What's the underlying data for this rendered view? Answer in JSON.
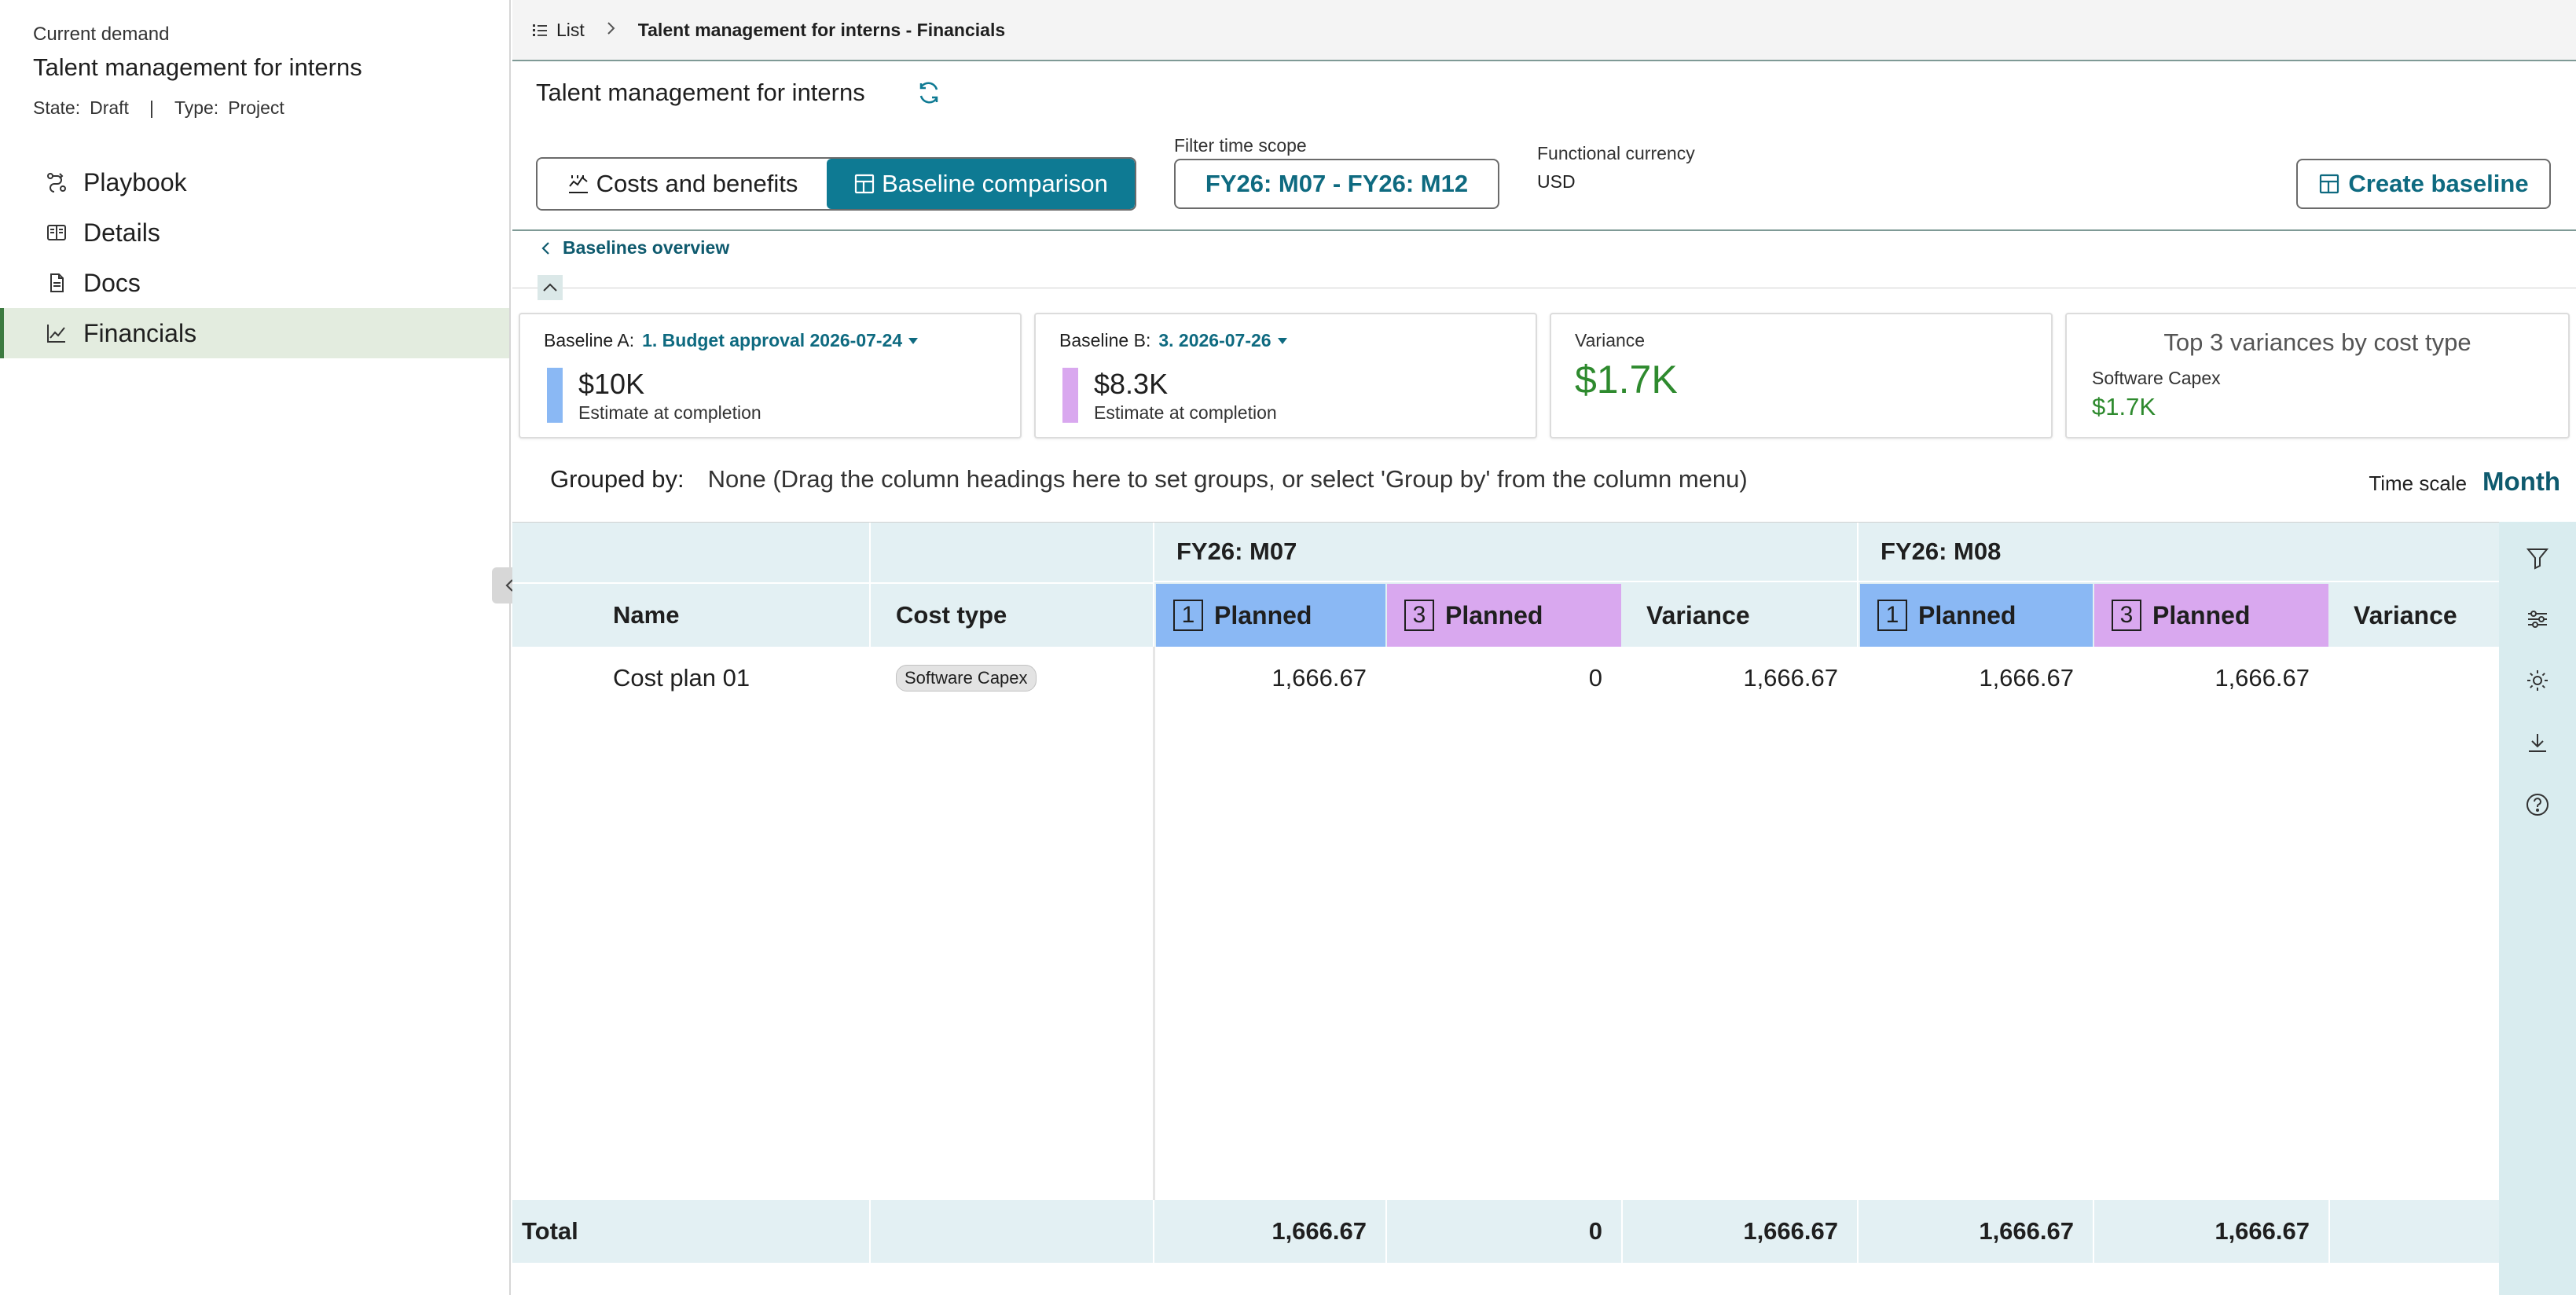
{
  "sidebar": {
    "context_label": "Current demand",
    "title": "Talent management for interns",
    "state_label": "State:",
    "state_value": "Draft",
    "separator": "|",
    "type_label": "Type:",
    "type_value": "Project",
    "items": [
      {
        "label": "Playbook",
        "icon": "playbook-icon",
        "active": false
      },
      {
        "label": "Details",
        "icon": "details-icon",
        "active": false
      },
      {
        "label": "Docs",
        "icon": "document-icon",
        "active": false
      },
      {
        "label": "Financials",
        "icon": "chart-line-icon",
        "active": true
      }
    ]
  },
  "breadcrumb": {
    "list_label": "List",
    "current": "Talent management for interns - Financials"
  },
  "header": {
    "title": "Talent management for interns",
    "tabs": [
      {
        "label": "Costs and benefits",
        "selected": false
      },
      {
        "label": "Baseline comparison",
        "selected": true
      }
    ],
    "filter_label": "Filter time scope",
    "filter_value": "FY26: M07 - FY26: M12",
    "currency_label": "Functional currency",
    "currency_value": "USD",
    "create_label": "Create baseline",
    "back_link": "Baselines overview"
  },
  "cards": {
    "baseline_a": {
      "label": "Baseline A:",
      "value": "1. Budget approval 2026-07-24",
      "amount": "$10K",
      "sub": "Estimate at completion",
      "color": "#8ab8f4"
    },
    "baseline_b": {
      "label": "Baseline B:",
      "value": "3. 2026-07-26",
      "amount": "$8.3K",
      "sub": "Estimate at completion",
      "color": "#d9a8ef"
    },
    "variance": {
      "label": "Variance",
      "value": "$1.7K"
    },
    "top3": {
      "title": "Top 3 variances by cost type",
      "item": "Software Capex",
      "value": "$1.7K"
    }
  },
  "grouping": {
    "label": "Grouped by:",
    "help": "None (Drag the column headings here to set groups, or select 'Group by' from the column menu)",
    "timescale_label": "Time scale",
    "timescale_value": "Month"
  },
  "grid": {
    "col_name": "Name",
    "col_cost_type": "Cost type",
    "months": [
      {
        "label": "FY26: M07",
        "cols": [
          {
            "num": "1",
            "label": "Planned"
          },
          {
            "num": "3",
            "label": "Planned"
          },
          {
            "label": "Variance"
          }
        ]
      },
      {
        "label": "FY26: M08",
        "cols": [
          {
            "num": "1",
            "label": "Planned"
          },
          {
            "num": "3",
            "label": "Planned"
          },
          {
            "label": "Variance"
          }
        ]
      }
    ],
    "rows": [
      {
        "name": "Cost plan 01",
        "cost_type": "Software Capex",
        "values": [
          "1,666.67",
          "0",
          "1,666.67",
          "1,666.67",
          "1,666.67",
          ""
        ]
      }
    ],
    "total": {
      "label": "Total",
      "values": [
        "1,666.67",
        "0",
        "1,666.67",
        "1,666.67",
        "1,666.67",
        ""
      ]
    }
  },
  "colors": {
    "accent": "#0e7a93",
    "baseline_a": "#8ab8f4",
    "baseline_b": "#d9a8ef",
    "positive": "#2e8a2e",
    "header_band": "#e3f0f3"
  }
}
